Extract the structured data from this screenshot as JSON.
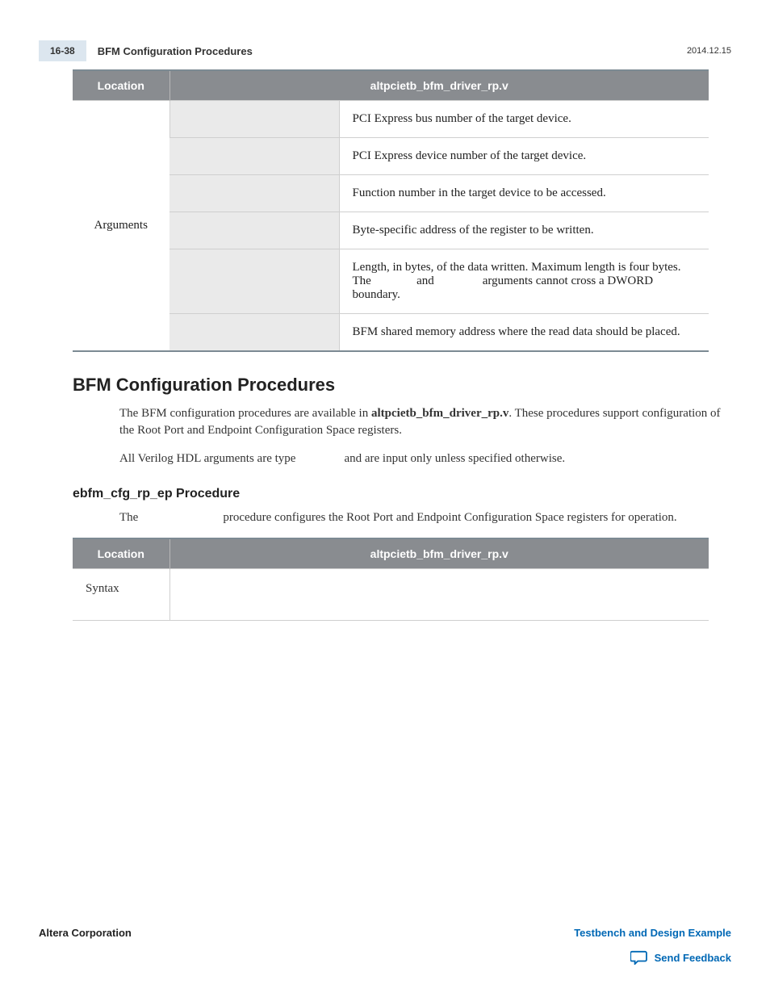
{
  "header": {
    "page_num": "16-38",
    "title": "BFM Configuration Procedures",
    "date": "2014.12.15"
  },
  "table1": {
    "head": {
      "c1": "Location",
      "c2": "altpcietb_bfm_driver_rp.v"
    },
    "rowspan_label": "Arguments",
    "rows": [
      {
        "desc": "PCI Express bus number of the target device."
      },
      {
        "desc": "PCI Express device number of the target device."
      },
      {
        "desc": "Function number in the target device to be accessed."
      },
      {
        "desc": "Byte-specific address of the register to be written."
      },
      {
        "desc_parts": {
          "p1": "Length, in bytes, of the data written. Maximum length is four bytes. The ",
          "p2": " and ",
          "p3": " arguments cannot cross a DWORD boundary."
        }
      },
      {
        "desc": "BFM shared memory address where the read data should be placed."
      }
    ]
  },
  "section": {
    "heading": "BFM Configuration Procedures",
    "p1a": "The BFM configuration procedures are available in ",
    "p1b": "altpcietb_bfm_driver_rp.v",
    "p1c": ". These procedures support configuration of the Root Port and Endpoint Configuration Space registers.",
    "p2a": "All Verilog HDL arguments are type ",
    "p2b": " and are input only unless specified otherwise."
  },
  "subsection": {
    "heading": "ebfm_cfg_rp_ep Procedure",
    "p1a": "The ",
    "p1b": " procedure configures the Root Port and Endpoint Configuration Space registers for operation."
  },
  "table2": {
    "head": {
      "c1": "Location",
      "c2": "altpcietb_bfm_driver_rp.v"
    },
    "row1_label": "Syntax"
  },
  "footer": {
    "corp": "Altera Corporation",
    "link": "Testbench and Design Example",
    "feedback": "Send Feedback"
  }
}
